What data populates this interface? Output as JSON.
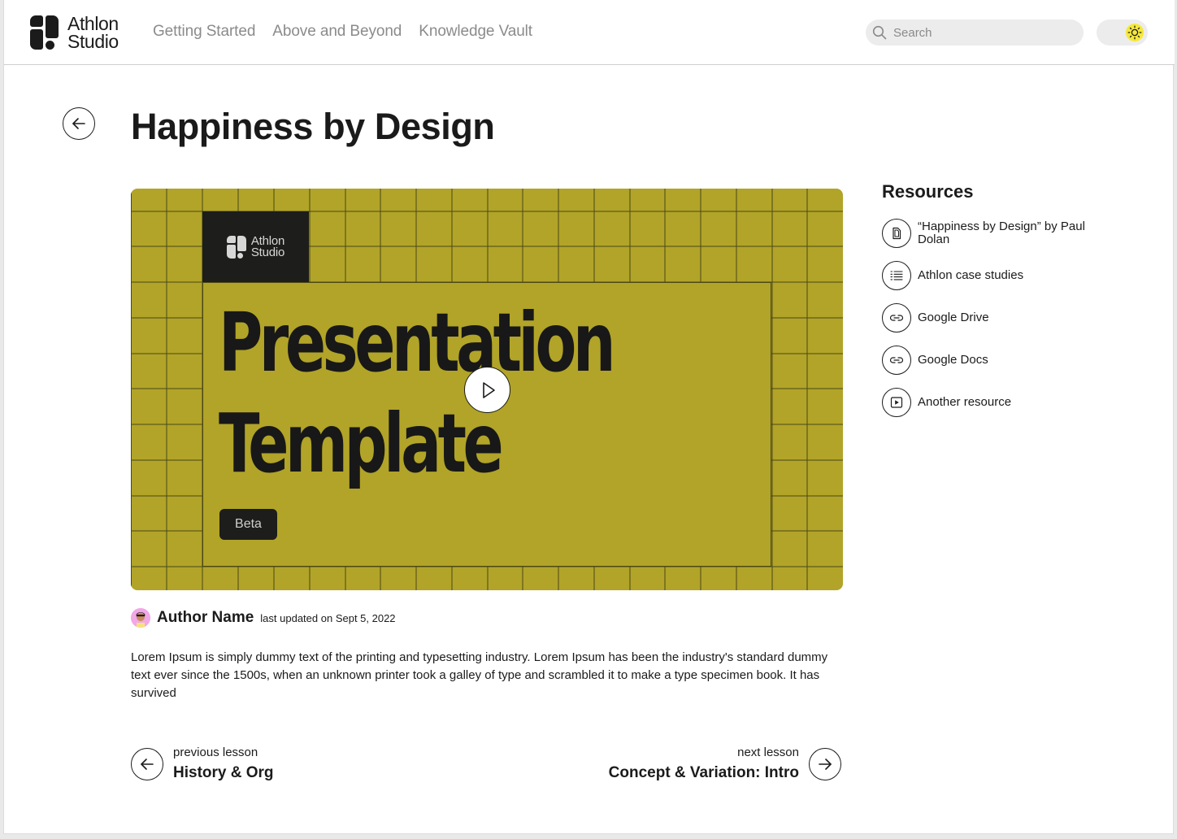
{
  "brand": {
    "line1": "Athlon",
    "line2": "Studio"
  },
  "nav": [
    {
      "label": "Getting Started"
    },
    {
      "label": "Above and Beyond"
    },
    {
      "label": "Knowledge Vault"
    }
  ],
  "search": {
    "placeholder": "Search"
  },
  "theme_toggle": {
    "icon": "sun-icon",
    "accent": "#f5e83a"
  },
  "page": {
    "title": "Happiness by Design"
  },
  "video": {
    "background": "#b1a428",
    "badge": {
      "line1": "Athlon",
      "line2": "Studio"
    },
    "headline1": "Presentation",
    "headline2": "Template",
    "tag": "Beta"
  },
  "author": {
    "name": "Author Name",
    "updated": "last updated on Sept 5, 2022"
  },
  "description": "Lorem Ipsum is simply dummy text of the printing and typesetting industry. Lorem Ipsum has been the industry's standard dummy text ever since the 1500s, when an unknown printer took a galley of type and scrambled it to make a type specimen book. It has survived",
  "lessons": {
    "previous": {
      "caption": "previous lesson",
      "title": "History & Org"
    },
    "next": {
      "caption": "next lesson",
      "title": "Concept & Variation: Intro"
    }
  },
  "resources": {
    "title": "Resources",
    "items": [
      {
        "label": "“Happiness by Design” by Paul Dolan",
        "icon": "document-icon"
      },
      {
        "label": "Athlon case studies",
        "icon": "list-icon"
      },
      {
        "label": "Google Drive",
        "icon": "link-icon"
      },
      {
        "label": "Google Docs",
        "icon": "link-icon"
      },
      {
        "label": "Another resource",
        "icon": "video-icon"
      }
    ]
  }
}
